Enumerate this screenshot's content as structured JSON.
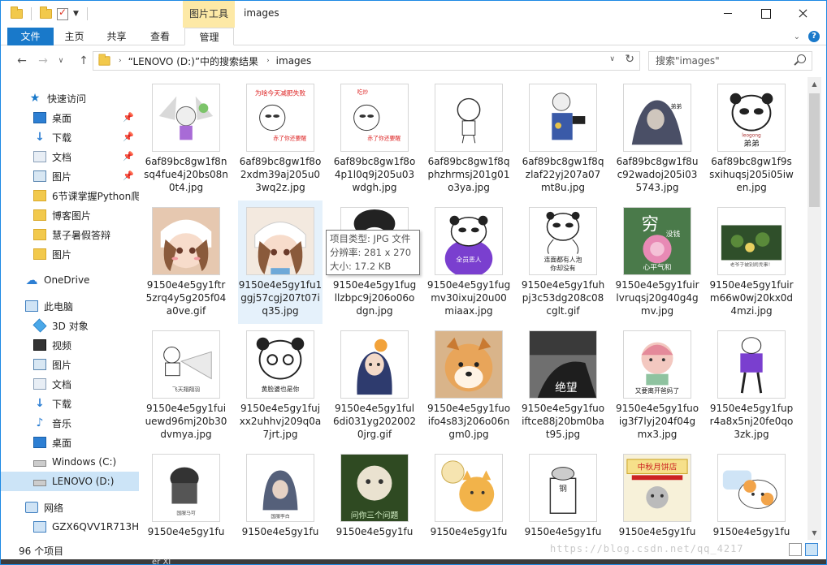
{
  "window": {
    "title": "images",
    "contextual_tab": "图片工具"
  },
  "ribbon": {
    "tabs": [
      "文件",
      "主页",
      "共享",
      "查看",
      "管理"
    ]
  },
  "address": {
    "crumbs": [
      "“LENOVO (D:)”中的搜索结果",
      "images"
    ],
    "search_placeholder": "搜索\"images\""
  },
  "navpane": {
    "items": [
      {
        "label": "快速访问",
        "icon": "quick-access-star-icon"
      },
      {
        "label": "桌面",
        "icon": "desktop-icon",
        "pinned": true
      },
      {
        "label": "下载",
        "icon": "download-icon",
        "pinned": true
      },
      {
        "label": "文档",
        "icon": "documents-icon",
        "pinned": true
      },
      {
        "label": "图片",
        "icon": "pictures-icon",
        "pinned": true
      },
      {
        "label": "6节课掌握Python爬",
        "icon": "folder-icon"
      },
      {
        "label": "博客图片",
        "icon": "folder-icon"
      },
      {
        "label": "慧子暑假答辩",
        "icon": "folder-icon"
      },
      {
        "label": "图片",
        "icon": "folder-icon"
      },
      {
        "label": "OneDrive",
        "icon": "onedrive-icon"
      },
      {
        "label": "此电脑",
        "icon": "this-pc-icon"
      },
      {
        "label": "3D 对象",
        "icon": "3d-objects-icon"
      },
      {
        "label": "视频",
        "icon": "videos-icon"
      },
      {
        "label": "图片",
        "icon": "pictures-icon"
      },
      {
        "label": "文档",
        "icon": "documents-icon"
      },
      {
        "label": "下载",
        "icon": "download-icon"
      },
      {
        "label": "音乐",
        "icon": "music-icon"
      },
      {
        "label": "桌面",
        "icon": "desktop-icon"
      },
      {
        "label": "Windows (C:)",
        "icon": "drive-icon"
      },
      {
        "label": "LENOVO (D:)",
        "icon": "drive-icon",
        "selected": true
      },
      {
        "label": "网络",
        "icon": "network-icon"
      },
      {
        "label": "GZX6QVV1R713H",
        "icon": "computer-icon"
      }
    ]
  },
  "files": [
    "6af89bc8gw1f8nsq4fue4j20bs08n0t4.jpg",
    "6af89bc8gw1f8o2xdm39aj205u03wq2z.jpg",
    "6af89bc8gw1f8o4p1l0q9j205u03wdgh.jpg",
    "6af89bc8gw1f8qphzhrmsj201g01o3ya.jpg",
    "6af89bc8gw1f8qzlaf22yj207a07mt8u.jpg",
    "6af89bc8gw1f8uc92wadoj205i035743.jpg",
    "6af89bc8gw1f9ssxihuqsj205i05iwen.jpg",
    "9150e4e5gy1ftr5zrq4y5g205f04a0ve.gif",
    "9150e4e5gy1fu1ggj57cgj207t07iq35.jpg",
    "9150e4e5gy1fugllzbpc9j206o06odgn.jpg",
    "9150e4e5gy1fugmv30ixuj20u00miaax.jpg",
    "9150e4e5gy1fuhpj3c53dg208c08cglt.gif",
    "9150e4e5gy1fuirlvruqsj20g40g4gmv.jpg",
    "9150e4e5gy1fuirm66w0wj20kx0d4mzi.jpg",
    "9150e4e5gy1fuiuewd96mj20b30dvmya.jpg",
    "9150e4e5gy1fujxx2uhhvj209q0a7jrt.jpg",
    "9150e4e5gy1ful6di031yg2020020jrg.gif",
    "9150e4e5gy1fuoifo4s83j206o06ngm0.jpg",
    "9150e4e5gy1fuoiftce88j20bm0bat95.jpg",
    "9150e4e5gy1fuoig3f7lyj204f04gmx3.jpg",
    "9150e4e5gy1fupr4a8x5nj20fe0qo3zk.jpg",
    "9150e4e5gy1fu",
    "9150e4e5gy1fu",
    "9150e4e5gy1fu",
    "9150e4e5gy1fu",
    "9150e4e5gy1fu",
    "9150e4e5gy1fu",
    "9150e4e5gy1fu"
  ],
  "thumb_texts": {
    "t1": "为啥今天减肥失败",
    "t1b": "赤了你还要醒",
    "t2": "吃炒",
    "t2b": "赤了你还要醒",
    "t5": "弟弟",
    "t6": "弟弟",
    "t6b": "leogong",
    "t11": "全员恶人",
    "t12": "连面都有人泡",
    "t12b": "你却没有",
    "t13": "穷",
    "t13b": "没钱",
    "t13c": "心平气和",
    "t15": "飞天翔翔羽",
    "t16": "黄脸婆也是你",
    "t19": "绝望",
    "t20": "又要离开爸妈了",
    "t23": "问你三个问题",
    "t26": "中秋月饼店"
  },
  "tooltip": {
    "type": "项目类型: JPG 文件",
    "dims": "分辨率: 281 x 270",
    "size": "大小: 17.2 KB"
  },
  "status": {
    "count": "96 个项目"
  },
  "watermark": "https://blog.csdn.net/qq_4217",
  "taskbar_text": "er XI",
  "colors": {
    "accent": "#1979ca",
    "selection": "#cce4f7",
    "context_tab": "#fde9a6"
  }
}
